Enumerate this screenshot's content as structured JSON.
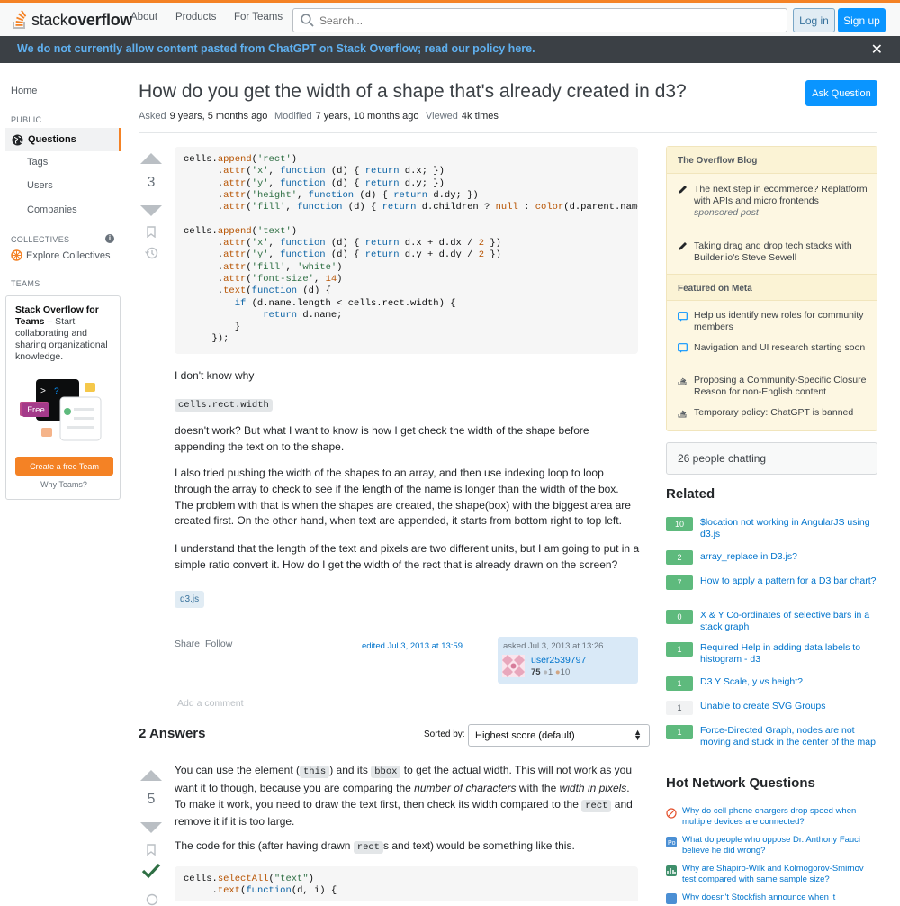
{
  "header": {
    "logo_text_regular": "stack",
    "logo_text_bold": "overflow",
    "nav": [
      "About",
      "Products",
      "For Teams"
    ],
    "search_placeholder": "Search...",
    "login": "Log in",
    "signup": "Sign up",
    "accent_color": "#f48225"
  },
  "banner": {
    "text": "We do not currently allow content pasted from ChatGPT on Stack Overflow; read our policy here.",
    "close": "✕"
  },
  "leftnav": {
    "home": "Home",
    "public_heading": "PUBLIC",
    "questions": "Questions",
    "tags": "Tags",
    "users": "Users",
    "companies": "Companies",
    "collectives_heading": "COLLECTIVES",
    "explore_collectives": "Explore Collectives",
    "teams_heading": "TEAMS",
    "teams_title": "Stack Overflow for Teams",
    "teams_desc": " – Start collaborating and sharing organizational knowledge.",
    "teams_free": "Free",
    "teams_cta": "Create a free Team",
    "teams_why": "Why Teams?"
  },
  "question": {
    "title": "How do you get the width of a shape that's already created in d3?",
    "ask_button": "Ask Question",
    "asked_label": "Asked",
    "asked_value": "9 years, 5 months ago",
    "modified_label": "Modified",
    "modified_value": "7 years, 10 months ago",
    "viewed_label": "Viewed",
    "viewed_value": "4k times",
    "score": "3",
    "p1": "I don't know why",
    "inline_code": "cells.rect.width",
    "p2": "doesn't work? But what I want to know is how I get check the width of the shape before appending the text on to the shape.",
    "p3": "I also tried pushing the width of the shapes to an array, and then use indexing loop to loop through the array to check to see if the length of the name is longer than the width of the box. The problem with that is when the shapes are created, the shape(box) with the biggest area are created first. On the other hand, when text are appended, it starts from bottom right to top left.",
    "p4": "I understand that the length of the text and pixels are two different units, but I am going to put in a simple ratio convert it. How do I get the width of the rect that is already drawn on the screen?",
    "tag": "d3.js",
    "share": "Share",
    "follow": "Follow",
    "edited": "edited Jul 3, 2013 at 13:59",
    "asked_card": "asked Jul 3, 2013 at 13:26",
    "user_name": "user2539797",
    "user_rep": "75",
    "user_silver": "1",
    "user_bronze": "10",
    "add_comment": "Add a comment"
  },
  "answers": {
    "heading": "2 Answers",
    "sorted_by": "Sorted by:",
    "sort_value": "Highest score (default)",
    "answer1_score": "5",
    "a1_p1_a": "You can use the element (",
    "a1_code_this": "this",
    "a1_p1_b": ") and its ",
    "a1_code_bbox": "bbox",
    "a1_p1_c": " to get the actual width. This will not work as you want it to though, because you are comparing the ",
    "a1_em1": "number of characters",
    "a1_p1_d": " with the ",
    "a1_em2": "width in pixels",
    "a1_p1_e": ". To make it work, you need to draw the text first, then check its width compared to the ",
    "a1_code_rect": "rect",
    "a1_p1_f": " and remove it if it is too large.",
    "a1_p2_a": "The code for this (after having drawn ",
    "a1_p2_code": "rect",
    "a1_p2_b": "s and text) would be something like this."
  },
  "sidebar": {
    "blog_heading": "The Overflow Blog",
    "blog_items": [
      "The next step in ecommerce? Replatform with APIs and micro frontends",
      "Taking drag and drop tech stacks with Builder.io's Steve Sewell"
    ],
    "blog_sponsored": "sponsored post",
    "meta_heading": "Featured on Meta",
    "meta_items": [
      "Help us identify new roles for community members",
      "Navigation and UI research starting soon",
      "Proposing a Community-Specific Closure Reason for non-English content",
      "Temporary policy: ChatGPT is banned"
    ],
    "chat": "26 people chatting",
    "related_heading": "Related",
    "related": [
      {
        "score": "10",
        "title": "$location not working in AngularJS using d3.js",
        "answered": true
      },
      {
        "score": "2",
        "title": "array_replace in D3.js?",
        "answered": true
      },
      {
        "score": "7",
        "title": "How to apply a pattern for a D3 bar chart?",
        "answered": true
      },
      {
        "score": "0",
        "title": "X & Y Co-ordinates of selective bars in a stack graph",
        "answered": true
      },
      {
        "score": "1",
        "title": "Required Help in adding data labels to histogram - d3",
        "answered": true
      },
      {
        "score": "1",
        "title": "D3 Y Scale, y vs height?",
        "answered": true
      },
      {
        "score": "1",
        "title": "Unable to create SVG Groups",
        "answered": false
      },
      {
        "score": "1",
        "title": "Force-Directed Graph, nodes are not moving and stuck in the center of the map",
        "answered": true
      }
    ],
    "hot_heading": "Hot Network Questions",
    "hot": [
      "Why do cell phone chargers drop speed when multiple devices are connected?",
      "What do people who oppose Dr. Anthony Fauci believe he did wrong?",
      "Why are Shapiro-Wilk and Kolmogorov-Smirnov test compared with same sample size?",
      "Why doesn't Stockfish announce when it"
    ]
  }
}
